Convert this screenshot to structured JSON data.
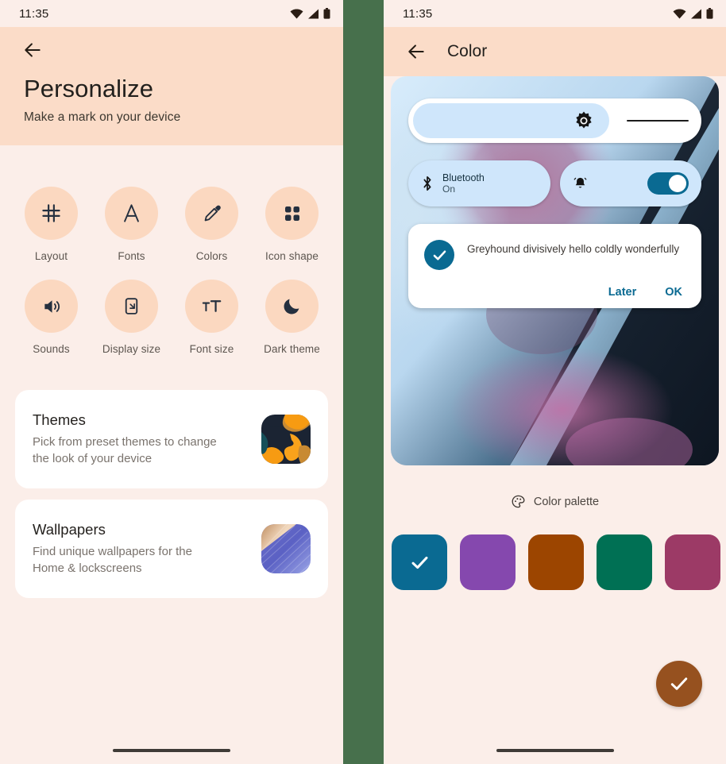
{
  "colors": {
    "header_bg": "#fbdcc8",
    "page_bg": "#fbeee9",
    "divider_green": "#47704c",
    "icon_circle": "#fbd8c0",
    "accent_blue": "#0a6a92",
    "fab_brown": "#96511f"
  },
  "left": {
    "status": {
      "time": "11:35",
      "wifi": "wifi-icon",
      "signal": "signal-icon",
      "battery": "battery-icon"
    },
    "back": "back-arrow-icon",
    "title": "Personalize",
    "subtitle": "Make a mark on your device",
    "grid": [
      {
        "icon": "grid-icon",
        "label": "Layout"
      },
      {
        "icon": "font-a-icon",
        "label": "Fonts"
      },
      {
        "icon": "eyedropper-icon",
        "label": "Colors"
      },
      {
        "icon": "app-shape-icon",
        "label": "Icon shape"
      },
      {
        "icon": "volume-icon",
        "label": "Sounds"
      },
      {
        "icon": "display-size-icon",
        "label": "Display size"
      },
      {
        "icon": "font-size-icon",
        "label": "Font size"
      },
      {
        "icon": "moon-icon",
        "label": "Dark theme"
      }
    ],
    "cards": [
      {
        "title": "Themes",
        "desc": "Pick from preset themes to change the look of your device",
        "thumb": "themes-thumbnail"
      },
      {
        "title": "Wallpapers",
        "desc": "Find unique wallpapers for the Home & lockscreens",
        "thumb": "wallpapers-thumbnail"
      }
    ]
  },
  "right": {
    "status": {
      "time": "11:35",
      "wifi": "wifi-icon",
      "signal": "signal-icon",
      "battery": "battery-icon"
    },
    "back": "back-arrow-icon",
    "title": "Color",
    "preview": {
      "brightness": {
        "icon": "brightness-icon",
        "fill_percent": 67
      },
      "tiles": [
        {
          "icon": "bluetooth-icon",
          "title": "Bluetooth",
          "sub": "On"
        },
        {
          "icon": "bell-icon",
          "toggle": "on"
        }
      ],
      "dialog": {
        "check": "check-circle-icon",
        "message": "Greyhound divisively hello coldly wonderfully",
        "actions": [
          "Later",
          "OK"
        ]
      }
    },
    "palette": {
      "icon": "palette-icon",
      "label": "Color palette",
      "swatches": [
        {
          "color": "#0a6a92",
          "selected": true
        },
        {
          "color": "#8548ae",
          "selected": false
        },
        {
          "color": "#9c4500",
          "selected": false
        },
        {
          "color": "#007054",
          "selected": false
        },
        {
          "color": "#9c3a66",
          "selected": false
        }
      ]
    },
    "fab": {
      "icon": "check-icon"
    }
  }
}
